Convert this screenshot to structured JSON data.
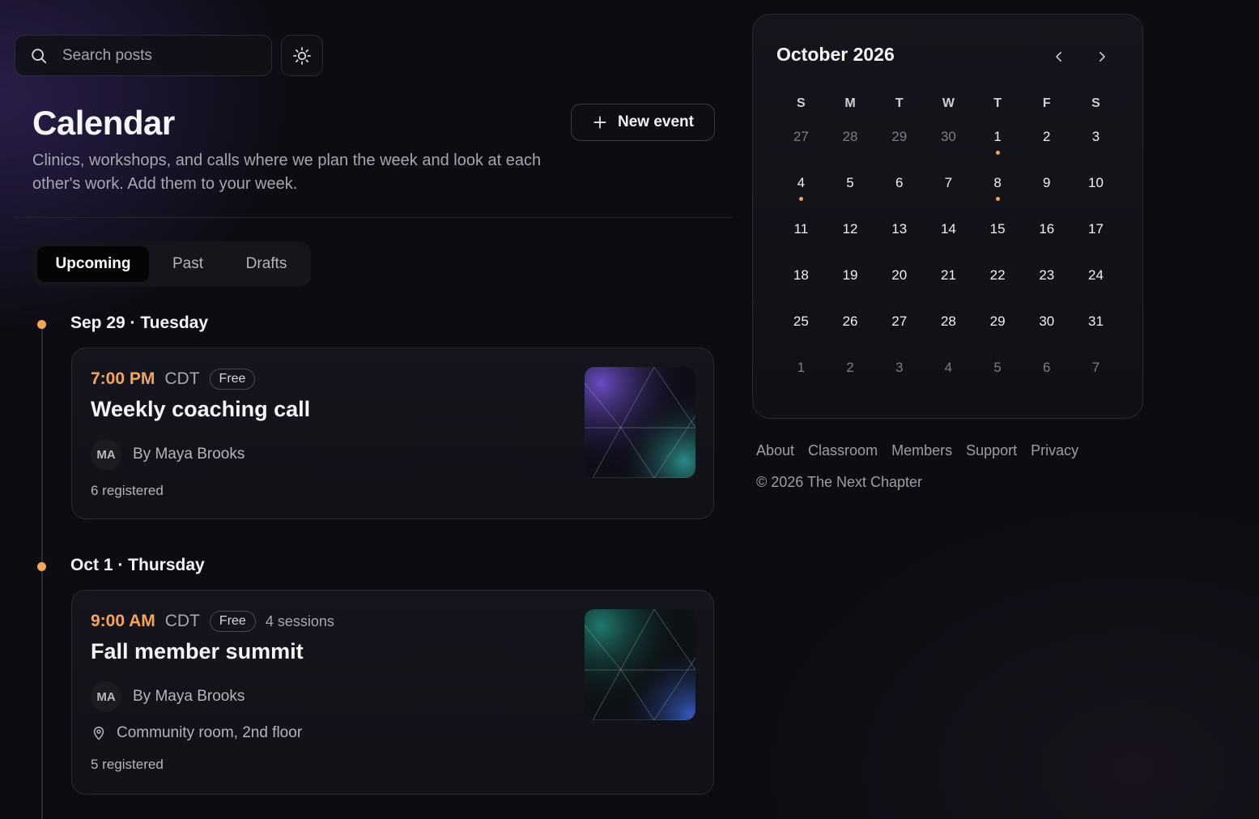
{
  "search": {
    "placeholder": "Search posts"
  },
  "header": {
    "title": "Calendar",
    "description": "Clinics, workshops, and calls where we plan the week and look at each other's work. Add them to your week.",
    "new_event_label": "New event"
  },
  "tabs": [
    {
      "label": "Upcoming",
      "active": true
    },
    {
      "label": "Past",
      "active": false
    },
    {
      "label": "Drafts",
      "active": false
    }
  ],
  "events": [
    {
      "date_heading": "Sep 29 · Tuesday",
      "time": "7:00 PM",
      "timezone": "CDT",
      "price_badge": "Free",
      "title": "Weekly coaching call",
      "host_initials": "MA",
      "host": "By Maya Brooks",
      "registered": "6 registered"
    },
    {
      "date_heading": "Oct 1 · Thursday",
      "time": "9:00 AM",
      "timezone": "CDT",
      "price_badge": "Free",
      "sessions": "4 sessions",
      "title": "Fall member summit",
      "host_initials": "MA",
      "host": "By Maya Brooks",
      "location": "Community room, 2nd floor",
      "registered": "5 registered"
    }
  ],
  "calendar": {
    "month_label": "October 2026",
    "weekdays": [
      "S",
      "M",
      "T",
      "W",
      "T",
      "F",
      "S"
    ],
    "weeks": [
      [
        {
          "d": "27",
          "muted": true
        },
        {
          "d": "28",
          "muted": true
        },
        {
          "d": "29",
          "muted": true
        },
        {
          "d": "30",
          "muted": true
        },
        {
          "d": "1",
          "event": true
        },
        {
          "d": "2"
        },
        {
          "d": "3"
        }
      ],
      [
        {
          "d": "4",
          "event": true
        },
        {
          "d": "5"
        },
        {
          "d": "6"
        },
        {
          "d": "7"
        },
        {
          "d": "8",
          "event": true
        },
        {
          "d": "9"
        },
        {
          "d": "10"
        }
      ],
      [
        {
          "d": "11"
        },
        {
          "d": "12"
        },
        {
          "d": "13"
        },
        {
          "d": "14"
        },
        {
          "d": "15"
        },
        {
          "d": "16"
        },
        {
          "d": "17"
        }
      ],
      [
        {
          "d": "18"
        },
        {
          "d": "19"
        },
        {
          "d": "20"
        },
        {
          "d": "21"
        },
        {
          "d": "22"
        },
        {
          "d": "23"
        },
        {
          "d": "24"
        }
      ],
      [
        {
          "d": "25"
        },
        {
          "d": "26"
        },
        {
          "d": "27"
        },
        {
          "d": "28"
        },
        {
          "d": "29"
        },
        {
          "d": "30"
        },
        {
          "d": "31"
        }
      ],
      [
        {
          "d": "1",
          "muted": true
        },
        {
          "d": "2",
          "muted": true
        },
        {
          "d": "3",
          "muted": true
        },
        {
          "d": "4",
          "muted": true
        },
        {
          "d": "5",
          "muted": true
        },
        {
          "d": "6",
          "muted": true
        },
        {
          "d": "7",
          "muted": true
        }
      ]
    ]
  },
  "footer": {
    "links": [
      "About",
      "Classroom",
      "Members",
      "Support",
      "Privacy"
    ],
    "copyright": "© 2026 The Next Chapter"
  },
  "colors": {
    "accent": "#f5a55b",
    "background": "#0c0c12",
    "card": "#15151d"
  },
  "icons": {
    "search": "search-icon",
    "theme": "sun-icon",
    "new_event": "plus-icon",
    "prev": "chevron-left-icon",
    "next": "chevron-right-icon",
    "location": "map-pin-icon"
  }
}
